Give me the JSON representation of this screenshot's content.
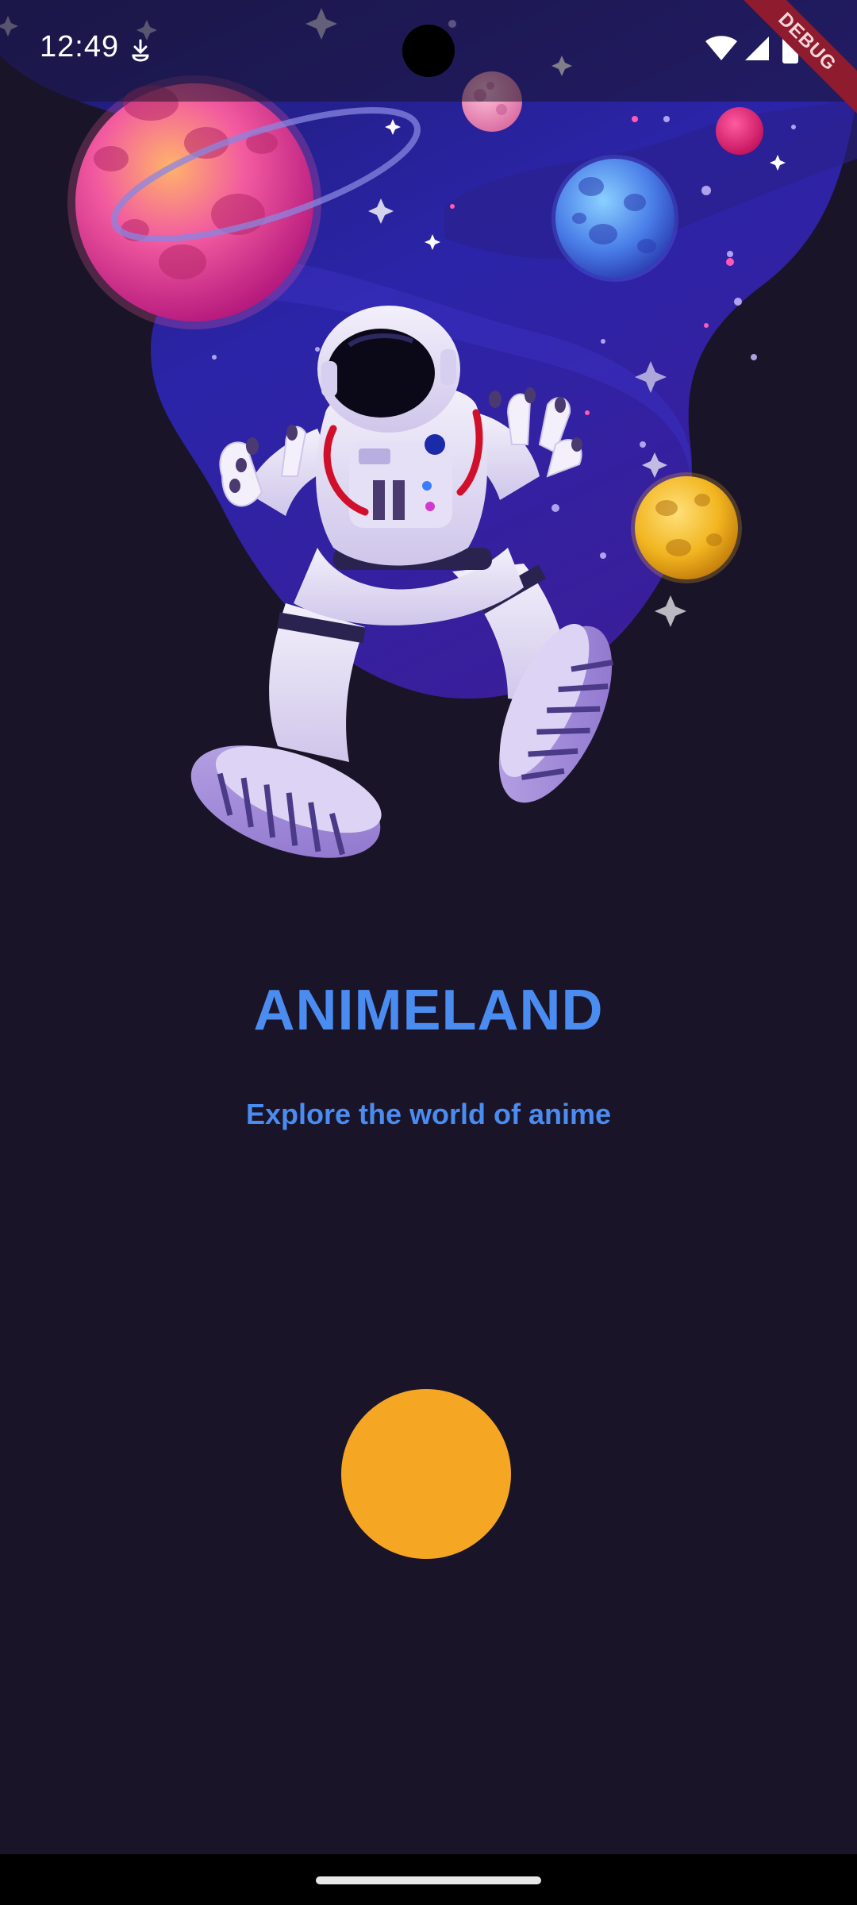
{
  "status_bar": {
    "time": "12:49",
    "notification_icon": "download-indicator-icon",
    "wifi_icon": "wifi-icon",
    "signal_icon": "cell-signal-icon",
    "battery_icon": "battery-icon"
  },
  "debug_banner": "DEBUG",
  "hero": {
    "illustration": "astronaut-floating-in-space-with-planets"
  },
  "app": {
    "title": "ANIMELAND",
    "subtitle": "Explore the world of anime"
  },
  "start_button": {
    "color": "#f5a623"
  },
  "colors": {
    "background": "#1a1428",
    "accent": "#4a8cf0",
    "button": "#f5a623"
  }
}
